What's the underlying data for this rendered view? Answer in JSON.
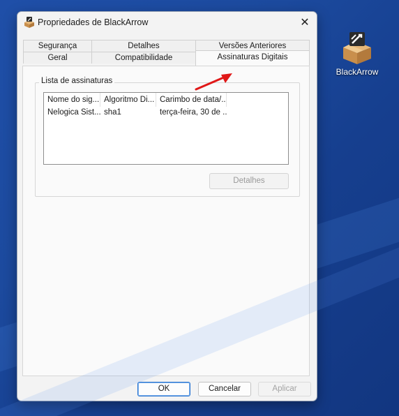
{
  "window": {
    "title": "Propriedades de BlackArrow",
    "close_symbol": "✕"
  },
  "desktop": {
    "icon_label": "BlackArrow"
  },
  "tabs": {
    "row1": [
      "Segurança",
      "Detalhes",
      "Versões Anteriores"
    ],
    "row2": [
      "Geral",
      "Compatibilidade"
    ],
    "active": "Assinaturas Digitais"
  },
  "signatures": {
    "group_title": "Lista de assinaturas",
    "columns": [
      "Nome do sig...",
      "Algoritmo Di...",
      "Carimbo de data/..."
    ],
    "rows": [
      [
        "Nelogica Sist...",
        "sha1",
        "terça-feira, 30 de ..."
      ]
    ],
    "details_label": "Detalhes"
  },
  "footer": {
    "ok_label": "OK",
    "cancel_label": "Cancelar",
    "apply_label": "Aplicar"
  },
  "colors": {
    "annotation_arrow": "#e01818",
    "desktop_blue": "#1c4a9e",
    "focus_blue": "#2a76d2"
  }
}
